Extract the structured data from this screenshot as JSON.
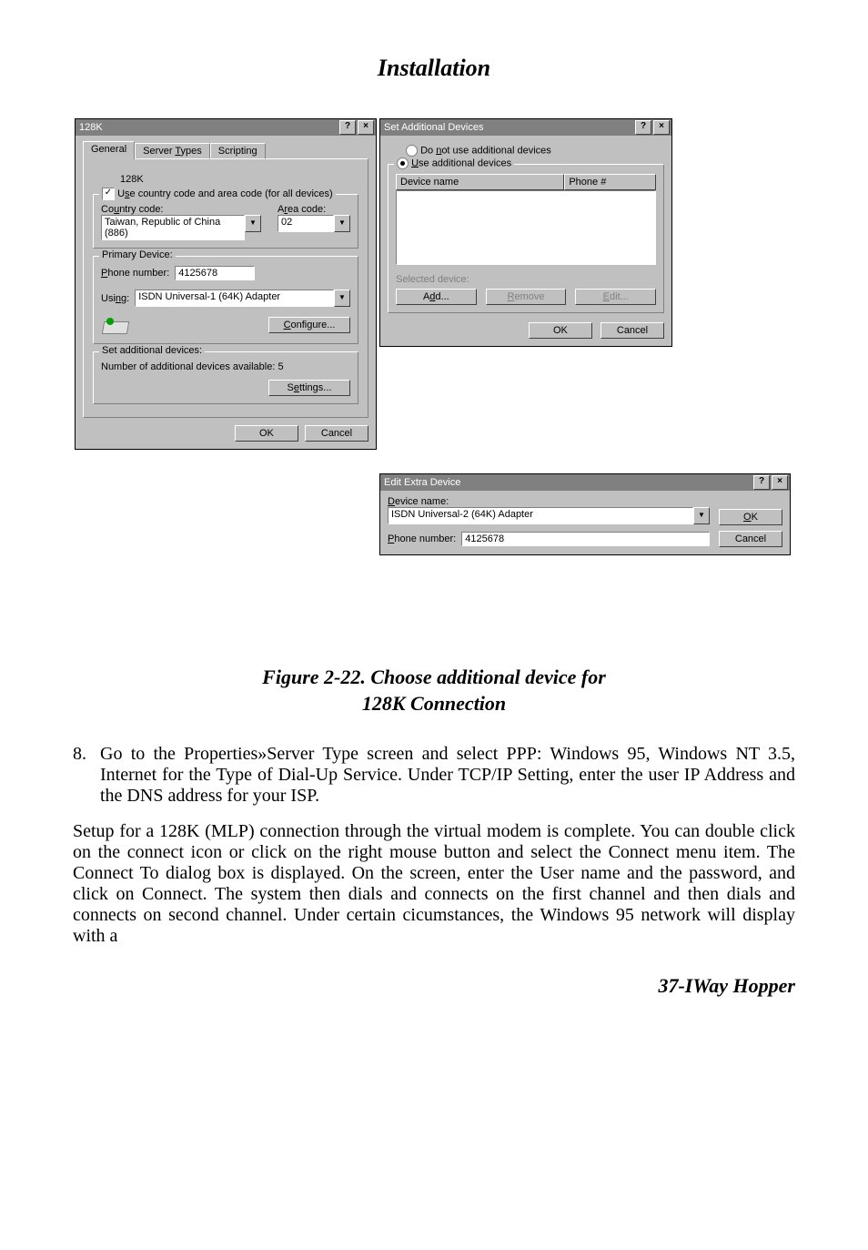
{
  "page": {
    "title_header": "Installation",
    "figure_caption_line1": "Figure 2-22. Choose additional device for",
    "figure_caption_line2": "128K Connection",
    "list_start": "8",
    "step8": "Go to the Properties»Server Type screen and select PPP: Windows 95, Windows NT 3.5, Internet for the Type of Dial-Up Service.  Under TCP/IP Setting, enter the user IP Address and the DNS address for your ISP.",
    "paragraph": "Setup for a 128K (MLP) connection through the virtual modem is complete.  You can double click on the connect icon or click on the right mouse button and select the Connect menu item.  The Connect To dialog box is displayed.  On the screen, enter the User name and the password, and click on Connect.  The system then dials and connects on the first channel and then dials and connects on second channel.  Under certain cicumstances, the Windows 95 network will display with a",
    "footer": "37-IWay Hopper"
  },
  "dlg128k": {
    "title": "128K",
    "help_btn": "?",
    "close_btn": "×",
    "tabs": {
      "general": "General",
      "server_types": "Server Types",
      "scripting": "Scripting"
    },
    "conn_name": "128K",
    "use_country_label": "Use country code and area code (for all devices)",
    "country_label": "Country code:",
    "country_value": "Taiwan, Republic of China (886)",
    "area_label": "Area code:",
    "area_value": "02",
    "primary_legend": "Primary Device:",
    "phone_label": "Phone number:",
    "phone_value": "4125678",
    "using_label": "Using:",
    "using_value": "ISDN Universal-1 (64K) Adapter",
    "configure_btn": "Configure...",
    "additional_legend": "Set additional devices:",
    "additional_count_label": "Number of additional devices available:   5",
    "settings_btn": "Settings...",
    "ok_btn": "OK",
    "cancel_btn": "Cancel"
  },
  "dlgSet": {
    "title": "Set Additional Devices",
    "help_btn": "?",
    "close_btn": "×",
    "opt_not_use": "Do not use additional devices",
    "opt_use": "Use additional devices",
    "col_device": "Device name",
    "col_phone": "Phone #",
    "selected_label": "Selected device:",
    "add_btn": "Add...",
    "remove_btn": "Remove",
    "edit_btn": "Edit...",
    "ok_btn": "OK",
    "cancel_btn": "Cancel"
  },
  "dlgEdit": {
    "title": "Edit Extra Device",
    "help_btn": "?",
    "close_btn": "×",
    "device_label": "Device name:",
    "device_value": "ISDN Universal-2 (64K) Adapter",
    "phone_label": "Phone number:",
    "phone_value": "4125678",
    "ok_btn": "OK",
    "cancel_btn": "Cancel"
  }
}
